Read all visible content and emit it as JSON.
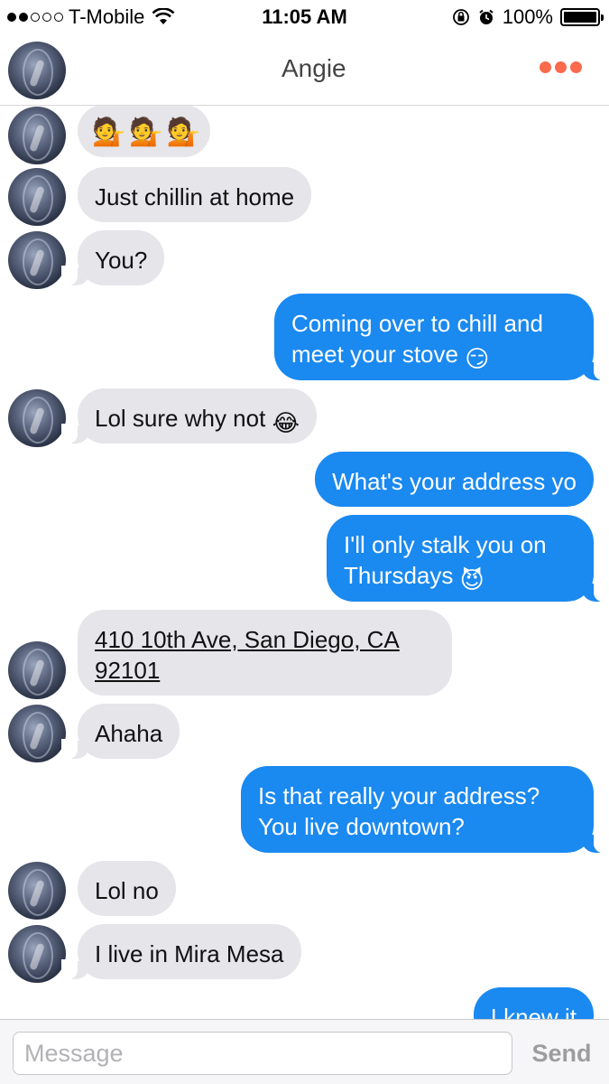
{
  "status_bar": {
    "carrier": "T-Mobile",
    "time": "11:05 AM",
    "battery": "100%",
    "signal_bars_filled": 2,
    "signal_bars_total": 5
  },
  "header": {
    "contact_name": "Angie",
    "back_icon": "back-arrow-icon",
    "more_icon": "more-options-icon"
  },
  "colors": {
    "accent": "#fa6a4c",
    "outgoing_bubble": "#1a89f0",
    "incoming_bubble": "#e5e5ea"
  },
  "messages": [
    {
      "from": "them",
      "text": "",
      "emoji": "💁💁💁"
    },
    {
      "from": "them",
      "text": "Just chillin at home"
    },
    {
      "from": "them",
      "text": "You?"
    },
    {
      "from": "me",
      "line1": "Coming over to chill and",
      "line2": "meet your stove",
      "emoji": "😏"
    },
    {
      "from": "them",
      "text": "Lol sure why not",
      "emoji": "😂"
    },
    {
      "from": "me",
      "text": "What's your address yo"
    },
    {
      "from": "me",
      "line1": "I'll only stalk you on",
      "line2": "Thursdays",
      "emoji": "😈"
    },
    {
      "from": "them",
      "line1": "410 10th Ave, San Diego, CA",
      "line2": "92101"
    },
    {
      "from": "them",
      "text": "Ahaha"
    },
    {
      "from": "me",
      "line1": "Is that really your address?",
      "line2": "You live downtown?"
    },
    {
      "from": "them",
      "text": "Lol no"
    },
    {
      "from": "them",
      "text": "I live in Mira Mesa"
    },
    {
      "from": "me",
      "text": "I knew it"
    }
  ],
  "composer": {
    "placeholder": "Message",
    "send_label": "Send"
  }
}
